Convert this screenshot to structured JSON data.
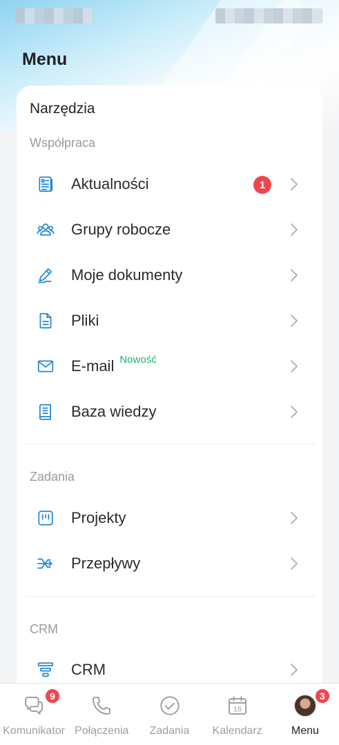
{
  "header": {
    "title": "Menu"
  },
  "section": {
    "title": "Narzędzia"
  },
  "groups": {
    "collaboration": "Współpraca",
    "tasks": "Zadania",
    "crm": "CRM"
  },
  "items": {
    "news": {
      "label": "Aktualności",
      "badge": "1"
    },
    "workgroups": {
      "label": "Grupy robocze"
    },
    "my_documents": {
      "label": "Moje dokumenty"
    },
    "files": {
      "label": "Pliki"
    },
    "email": {
      "label": "E-mail",
      "tag": "Nowość"
    },
    "knowledge_base": {
      "label": "Baza wiedzy"
    },
    "projects": {
      "label": "Projekty"
    },
    "workflows": {
      "label": "Przepływy"
    },
    "crm": {
      "label": "CRM"
    }
  },
  "bottom_nav": {
    "messenger": {
      "label": "Komunikator",
      "badge": "9"
    },
    "calls": {
      "label": "Połączenia"
    },
    "tasks": {
      "label": "Zadania"
    },
    "calendar": {
      "label": "Kalendarz",
      "day": "16"
    },
    "menu": {
      "label": "Menu",
      "badge": "3"
    }
  },
  "colors": {
    "accent_blue": "#1e87d4",
    "badge_red": "#f0464d",
    "new_green": "#19b56c"
  }
}
